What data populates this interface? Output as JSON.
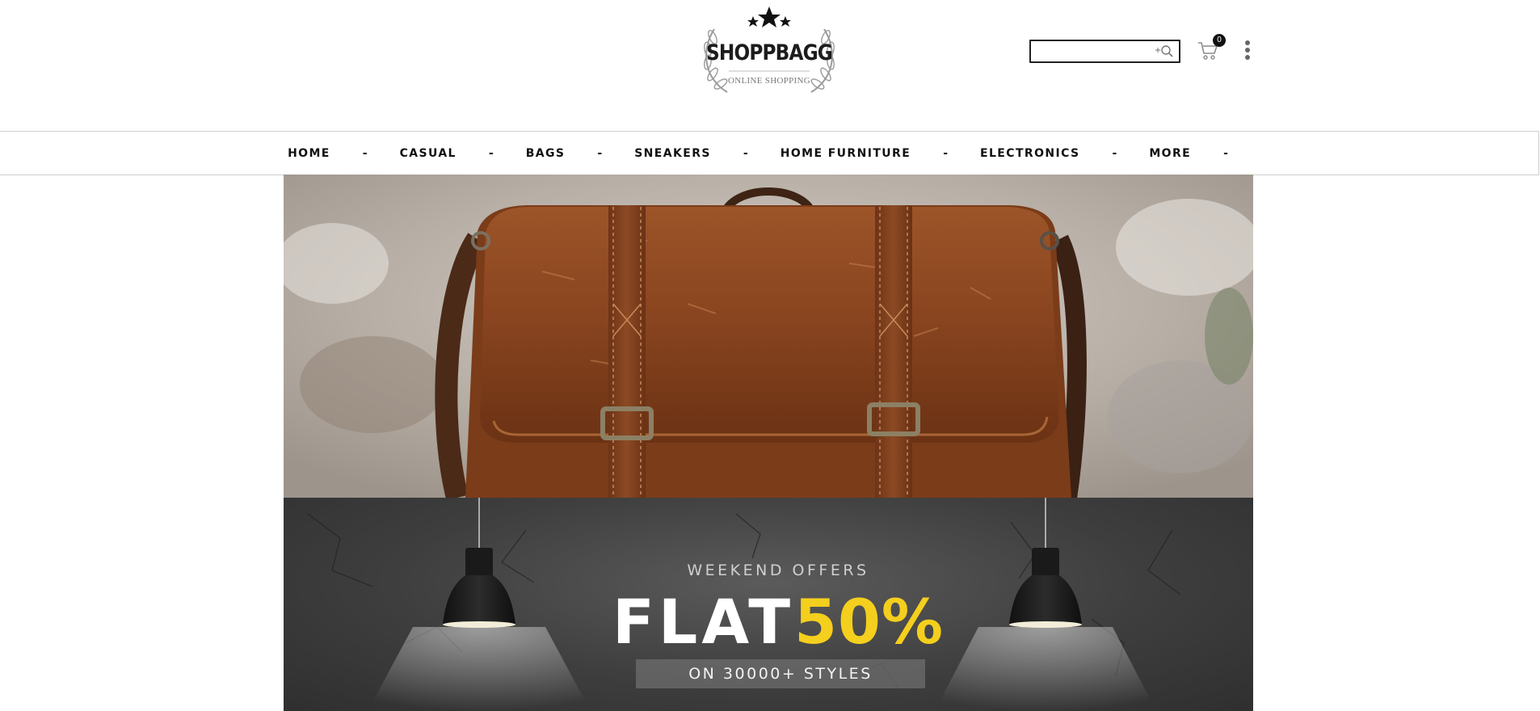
{
  "brand": {
    "name": "SHOPPBAGG",
    "tagline": "ONLINE SHOPPING"
  },
  "search": {
    "placeholder": "",
    "value": ""
  },
  "cart": {
    "count": "0"
  },
  "nav": {
    "items": [
      {
        "label": "HOME"
      },
      {
        "label": "CASUAL"
      },
      {
        "label": "BAGS"
      },
      {
        "label": "SNEAKERS"
      },
      {
        "label": "HOME FURNITURE"
      },
      {
        "label": "ELECTRONICS"
      },
      {
        "label": "MORE"
      }
    ],
    "separator": "-"
  },
  "promo": {
    "kicker": "WEEKEND OFFERS",
    "headline": "FLAT",
    "highlight": "50%",
    "subline": "ON 30000+ STYLES"
  },
  "colors": {
    "accent": "#f4cf1d",
    "text": "#111111",
    "nav_border": "#cfcfcf"
  }
}
